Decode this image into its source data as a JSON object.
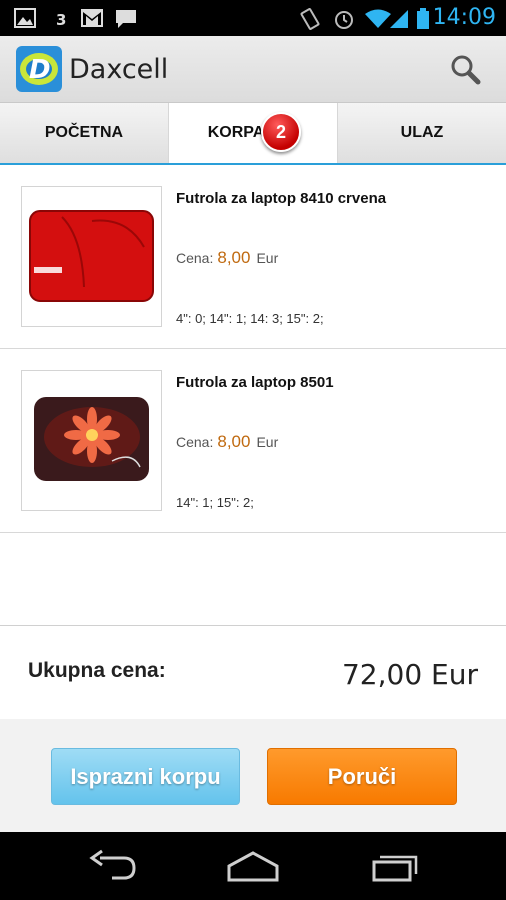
{
  "status_bar": {
    "time": "14:09",
    "icons": [
      "image-icon",
      "network-3g-icon",
      "gmail-icon",
      "message-icon",
      "vibrate-icon",
      "alarm-icon",
      "wifi-icon",
      "signal-icon",
      "battery-icon"
    ]
  },
  "action_bar": {
    "title": "Daxcell",
    "logo_letter": "D",
    "search_icon": "search-icon"
  },
  "tabs": [
    {
      "label": "POČETNA",
      "active": false
    },
    {
      "label": "KORPA",
      "active": true,
      "badge": "2"
    },
    {
      "label": "ULAZ",
      "active": false
    }
  ],
  "cart": {
    "items": [
      {
        "title": "Futrola za laptop 8410 crvena",
        "price_label": "Cena:",
        "price": "8,00",
        "currency": "Eur",
        "sizes": "4\": 0; 14\": 1; 14: 3; 15\": 2;"
      },
      {
        "title": "Futrola za laptop 8501",
        "price_label": "Cena:",
        "price": "8,00",
        "currency": "Eur",
        "sizes": "14\": 1; 15\": 2;"
      }
    ],
    "total_label": "Ukupna cena:",
    "total_value": "72,00 Eur",
    "empty_button": "Isprazni korpu",
    "order_button": "Poruči"
  },
  "colors": {
    "accent": "#2a9fd9",
    "price": "#c06a10",
    "order_button": "#f77a00",
    "empty_button": "#64c3ec"
  }
}
